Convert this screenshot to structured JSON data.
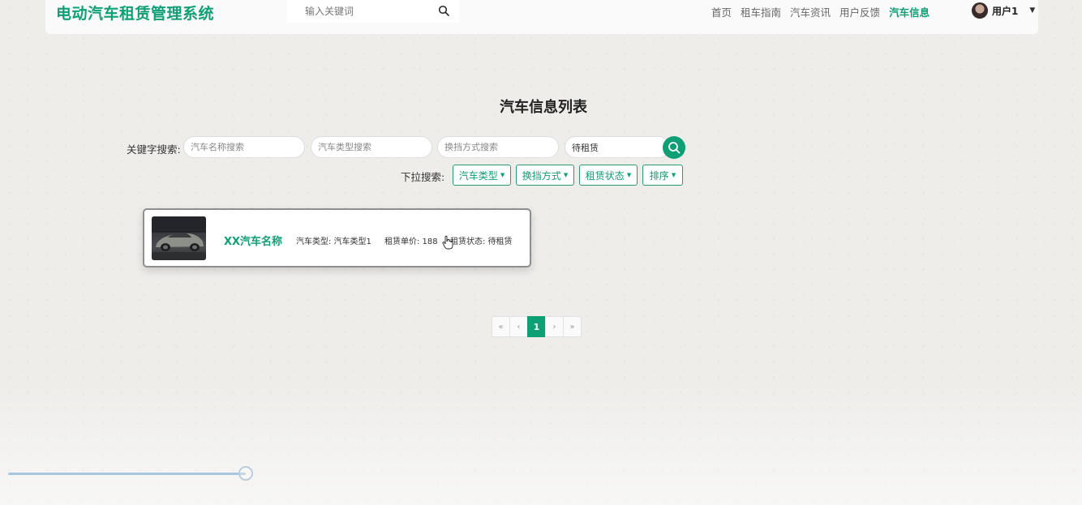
{
  "header": {
    "logo": "电动汽车租赁管理系统",
    "search_placeholder": "输入关键词",
    "nav": [
      "首页",
      "租车指南",
      "汽车资讯",
      "用户反馈",
      "汽车信息"
    ],
    "active_nav": "汽车信息",
    "user_name": "用户1"
  },
  "page_title": "汽车信息列表",
  "keyword_search": {
    "label": "关键字搜索:",
    "fields": [
      {
        "placeholder": "汽车名称搜索",
        "value": ""
      },
      {
        "placeholder": "汽车类型搜索",
        "value": ""
      },
      {
        "placeholder": "换挡方式搜索",
        "value": ""
      },
      {
        "placeholder": "",
        "value": "待租赁"
      }
    ]
  },
  "dropdown_search": {
    "label": "下拉搜索:",
    "buttons": [
      "汽车类型",
      "换挡方式",
      "租赁状态",
      "排序"
    ]
  },
  "cars": [
    {
      "name": "XX汽车名称",
      "type_text": "汽车类型: 汽车类型1",
      "price_text": "租赁单价: 188",
      "status_text": "租赁状态: 待租赁"
    }
  ],
  "pagination": {
    "first": "«",
    "prev": "‹",
    "current": "1",
    "next": "›",
    "last": "»"
  },
  "video_progress": 0.22,
  "colors": {
    "accent": "#0f9f74",
    "background": "#eeedea"
  }
}
